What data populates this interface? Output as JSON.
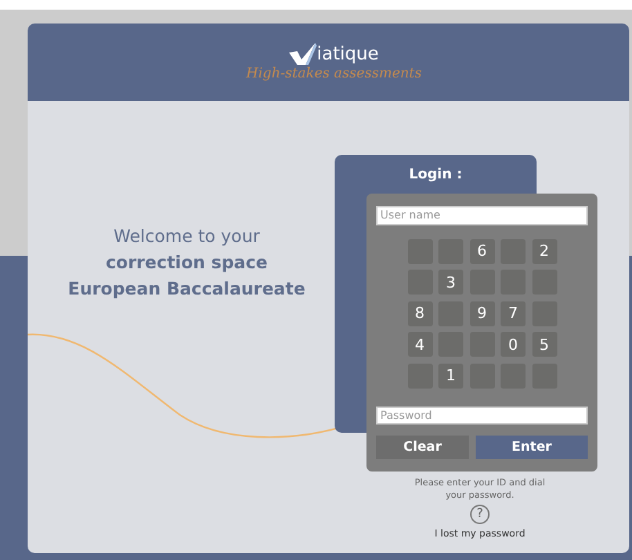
{
  "header": {
    "logo_text": "iatique",
    "tagline": "High-stakes assessments"
  },
  "welcome": "Welcome to your\n**correction space\nEuropean Baccalaureate**",
  "login": {
    "title": "Login :",
    "username": {
      "placeholder": "User name"
    },
    "password": {
      "placeholder": "Password"
    },
    "keypad": [
      {
        "kind": "blank"
      },
      {
        "kind": "blank"
      },
      {
        "kind": "digit",
        "label": "6"
      },
      {
        "kind": "blank"
      },
      {
        "kind": "digit",
        "label": "2"
      },
      {
        "kind": "blank"
      },
      {
        "kind": "digit",
        "label": "3"
      },
      {
        "kind": "blank"
      },
      {
        "kind": "blank"
      },
      {
        "kind": "blank"
      },
      {
        "kind": "digit",
        "label": "8"
      },
      {
        "kind": "blank"
      },
      {
        "kind": "digit",
        "label": "9"
      },
      {
        "kind": "digit",
        "label": "7"
      },
      {
        "kind": "blank"
      },
      {
        "kind": "digit",
        "label": "4"
      },
      {
        "kind": "blank"
      },
      {
        "kind": "blank"
      },
      {
        "kind": "digit",
        "label": "0"
      },
      {
        "kind": "digit",
        "label": "5"
      },
      {
        "kind": "blank"
      },
      {
        "kind": "digit",
        "label": "1"
      },
      {
        "kind": "blank"
      },
      {
        "kind": "blank"
      },
      {
        "kind": "blank"
      }
    ],
    "buttons": [
      {
        "kind": "secondary",
        "label": "Clear"
      },
      {
        "kind": "primary",
        "label": "Enter"
      }
    ]
  },
  "help": {
    "text": "Please enter your ID and dial your password.",
    "icon": "?",
    "link": "I lost my password"
  }
}
